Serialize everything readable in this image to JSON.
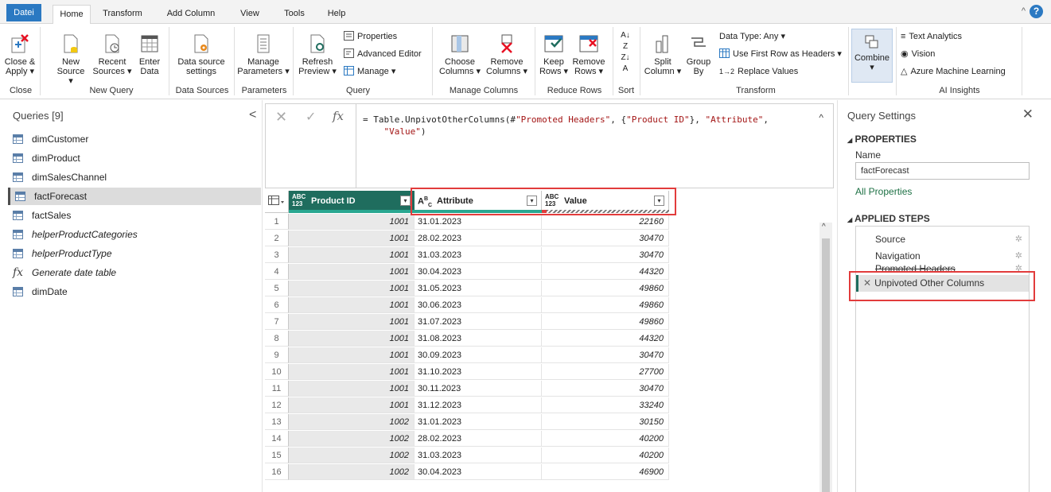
{
  "menu": {
    "tabs": [
      "Datei",
      "Home",
      "Transform",
      "Add Column",
      "View",
      "Tools",
      "Help"
    ],
    "active": "Home"
  },
  "ribbon": {
    "close_apply": "Close &\nApply",
    "new_source": "New\nSource",
    "recent_sources": "Recent\nSources",
    "enter_data": "Enter\nData",
    "data_source_settings": "Data source\nsettings",
    "manage_parameters": "Manage\nParameters",
    "refresh_preview": "Refresh\nPreview",
    "properties": "Properties",
    "advanced_editor": "Advanced Editor",
    "manage": "Manage",
    "choose_columns": "Choose\nColumns",
    "remove_columns": "Remove\nColumns",
    "keep_rows": "Keep\nRows",
    "remove_rows": "Remove\nRows",
    "split_column": "Split\nColumn",
    "group_by": "Group\nBy",
    "data_type": "Data Type: Any",
    "use_first_row": "Use First Row as Headers",
    "replace_values": "Replace Values",
    "combine": "Combine",
    "text_analytics": "Text Analytics",
    "vision": "Vision",
    "azure_ml": "Azure Machine Learning",
    "groups": [
      "Close",
      "New Query",
      "Data Sources",
      "Parameters",
      "Query",
      "Manage Columns",
      "Reduce Rows",
      "Sort",
      "Transform",
      "AI Insights"
    ]
  },
  "queries": {
    "title": "Queries [9]",
    "items": [
      {
        "label": "dimCustomer",
        "icon": "table-icon",
        "italic": false
      },
      {
        "label": "dimProduct",
        "icon": "table-icon",
        "italic": false
      },
      {
        "label": "dimSalesChannel",
        "icon": "table-icon",
        "italic": false
      },
      {
        "label": "factForecast",
        "icon": "table-icon",
        "italic": false,
        "selected": true
      },
      {
        "label": "factSales",
        "icon": "table-icon",
        "italic": false
      },
      {
        "label": "helperProductCategories",
        "icon": "table-icon",
        "italic": true
      },
      {
        "label": "helperProductType",
        "icon": "table-icon",
        "italic": true
      },
      {
        "label": "Generate date table",
        "icon": "function-icon",
        "italic": true
      },
      {
        "label": "dimDate",
        "icon": "table-icon",
        "italic": false
      }
    ]
  },
  "formula": {
    "prefix": "= Table.UnpivotOtherColumns(#",
    "s1": "\"Promoted Headers\"",
    "mid": ", {",
    "s2": "\"Product ID\"",
    "mid2": "}, ",
    "s3": "\"Attribute\"",
    "comma": ",",
    "s4": "\"Value\"",
    "end": ")"
  },
  "grid": {
    "columns": [
      {
        "name": "Product ID",
        "type": "ABC\n123"
      },
      {
        "name": "Attribute",
        "type": "A B C"
      },
      {
        "name": "Value",
        "type": "ABC\n123"
      }
    ],
    "rows": [
      [
        "1",
        "1001",
        "31.01.2023",
        "22160"
      ],
      [
        "2",
        "1001",
        "28.02.2023",
        "30470"
      ],
      [
        "3",
        "1001",
        "31.03.2023",
        "30470"
      ],
      [
        "4",
        "1001",
        "30.04.2023",
        "44320"
      ],
      [
        "5",
        "1001",
        "31.05.2023",
        "49860"
      ],
      [
        "6",
        "1001",
        "30.06.2023",
        "49860"
      ],
      [
        "7",
        "1001",
        "31.07.2023",
        "49860"
      ],
      [
        "8",
        "1001",
        "31.08.2023",
        "44320"
      ],
      [
        "9",
        "1001",
        "30.09.2023",
        "30470"
      ],
      [
        "10",
        "1001",
        "31.10.2023",
        "27700"
      ],
      [
        "11",
        "1001",
        "30.11.2023",
        "30470"
      ],
      [
        "12",
        "1001",
        "31.12.2023",
        "33240"
      ],
      [
        "13",
        "1002",
        "31.01.2023",
        "30150"
      ],
      [
        "14",
        "1002",
        "28.02.2023",
        "40200"
      ],
      [
        "15",
        "1002",
        "31.03.2023",
        "40200"
      ],
      [
        "16",
        "1002",
        "30.04.2023",
        "46900"
      ]
    ]
  },
  "settings": {
    "title": "Query Settings",
    "properties_header": "PROPERTIES",
    "name_label": "Name",
    "name_value": "factForecast",
    "all_properties": "All Properties",
    "applied_steps_header": "APPLIED STEPS",
    "steps": [
      "Source",
      "Navigation",
      "Promoted Headers",
      "Unpivoted Other Columns"
    ]
  },
  "colors": {
    "accent": "#2b79c2",
    "selected_column": "#1f6d5e",
    "quality_bar": "#2aa791",
    "highlight": "#e23c3c"
  }
}
